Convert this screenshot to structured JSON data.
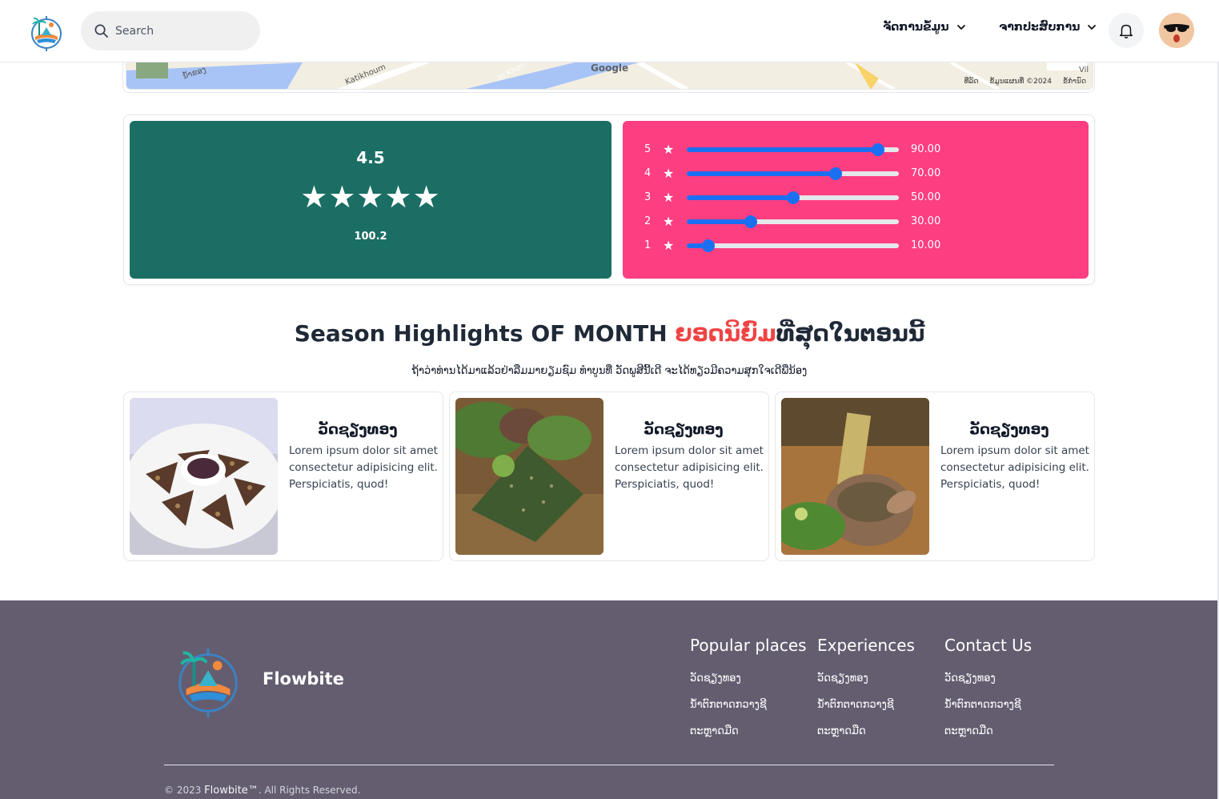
{
  "header": {
    "search_placeholder": "Search",
    "menu_data": "ຈັດການຂໍ້ມູນ",
    "menu_experience": "ຈາກປະສົບການ"
  },
  "map": {
    "google": "Google",
    "labels": [
      "ນ້ຳຂອງ",
      "Katikhoum",
      "m Khan",
      "Vil"
    ],
    "footer": [
      "ທີ່ລັດ",
      "ຂໍ້ມູນແຜນທີ່ ©2024",
      "ຂໍ້ກຳນົດ"
    ]
  },
  "rating": {
    "score": "4.5",
    "stars": "★★★★★",
    "count": "100.2",
    "bars": [
      {
        "star": "5",
        "value": 90,
        "label": "90.00"
      },
      {
        "star": "4",
        "value": 70,
        "label": "70.00"
      },
      {
        "star": "3",
        "value": 50,
        "label": "50.00"
      },
      {
        "star": "2",
        "value": 30,
        "label": "30.00"
      },
      {
        "star": "1",
        "value": 10,
        "label": "10.00"
      }
    ]
  },
  "highlights": {
    "title_pre": "Season Highlights OF MONTH ",
    "title_accent": "ຍອດນິຍົມ",
    "title_post": "ທີ່ສຸດໃນຕອນນີ້",
    "subtitle": "ຖ້າວ່າທ່ານໄດ້ມາແລ້ວຢ່າລືມມາຍຽມຊົມ ທຳບູນທີ່ ວັດພູສີນີ້ເດີ ຈະໄດ້ທຽວມີຄວາມສຸກໃຈເດີພີ່ນ້ອງ",
    "cards": [
      {
        "title": "ວັດຊຽງທອງ",
        "desc": "Lorem ipsum dolor sit amet consectetur adipisicing elit. Perspiciatis, quod!"
      },
      {
        "title": "ວັດຊຽງທອງ",
        "desc": "Lorem ipsum dolor sit amet consectetur adipisicing elit. Perspiciatis, quod!"
      },
      {
        "title": "ວັດຊຽງທອງ",
        "desc": "Lorem ipsum dolor sit amet consectetur adipisicing elit. Perspiciatis, quod!"
      }
    ]
  },
  "footer": {
    "brand": "Flowbite",
    "columns": [
      {
        "heading": "Popular places",
        "links": [
          "ວັດຊຽງທອງ",
          "ນ້ຳຕົກຕາດກວາງຊີ",
          "ຕະຫຼາດມືດ"
        ]
      },
      {
        "heading": "Experiences",
        "links": [
          "ວັດຊຽງທອງ",
          "ນ້ຳຕົກຕາດກວາງຊີ",
          "ຕະຫຼາດມືດ"
        ]
      },
      {
        "heading": "Contact Us",
        "links": [
          "ວັດຊຽງທອງ",
          "ນ້ຳຕົກຕາດກວາງຊີ",
          "ຕະຫຼາດມືດ"
        ]
      }
    ],
    "copyright_pre": "© 2023 ",
    "copyright_brand": "Flowbite™",
    "copyright_post": ". All Rights Reserved."
  },
  "colors": {
    "teal": "#1b6e64",
    "pink": "#fd3e81",
    "accent_red": "#ef4444",
    "slider_blue": "#1d6ff2",
    "footer_bg": "#645d70"
  },
  "icons": [
    "search-icon",
    "chevron-down-icon",
    "bell-icon",
    "avatar",
    "logo-icon",
    "star-icon"
  ]
}
